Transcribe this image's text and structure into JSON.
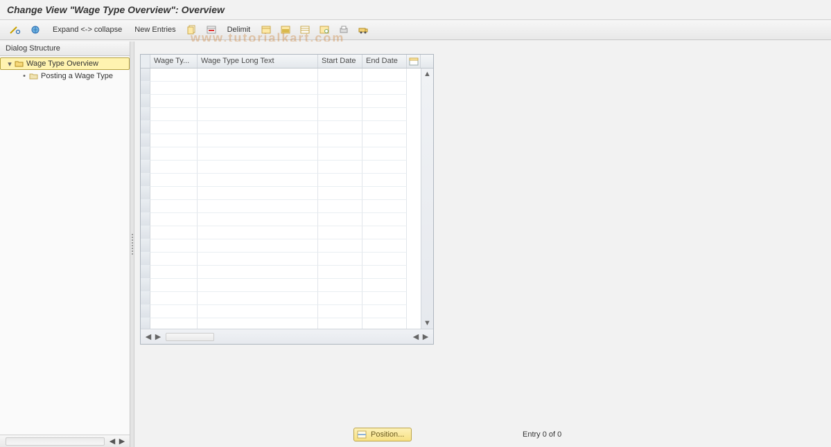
{
  "title": "Change View \"Wage Type Overview\": Overview",
  "watermark": "www.tutorialkart.com",
  "toolbar": {
    "expand_collapse": "Expand <-> collapse",
    "new_entries": "New Entries",
    "delimit": "Delimit"
  },
  "sidebar": {
    "header": "Dialog Structure",
    "items": [
      {
        "label": "Wage Type Overview",
        "selected": true,
        "icon": "folder-open"
      },
      {
        "label": "Posting a Wage Type",
        "selected": false,
        "icon": "folder"
      }
    ]
  },
  "table": {
    "columns": {
      "wage_type": "Wage Ty...",
      "long_text": "Wage Type Long Text",
      "start_date": "Start Date",
      "end_date": "End Date"
    },
    "rows": [],
    "visible_row_count": 20
  },
  "footer": {
    "position_label": "Position...",
    "entry_text": "Entry 0 of 0"
  }
}
